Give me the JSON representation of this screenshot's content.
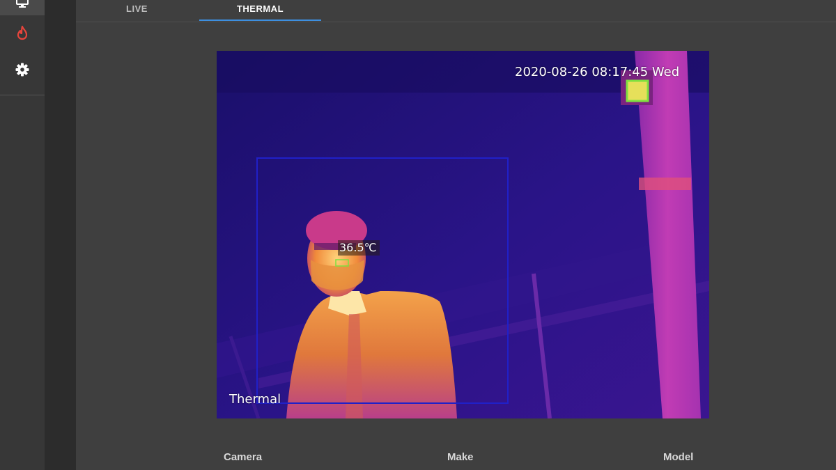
{
  "sidebar": {
    "items": [
      {
        "name": "monitor",
        "icon": "monitor-icon",
        "active": true
      },
      {
        "name": "thermal",
        "icon": "flame-icon",
        "color": "#e8453c"
      },
      {
        "name": "settings",
        "icon": "gear-icon"
      }
    ]
  },
  "tabs": [
    {
      "label": "LIVE",
      "active": false
    },
    {
      "label": "THERMAL",
      "active": true
    }
  ],
  "feed": {
    "timestamp": "2020-08-26 08:17:45 Wed",
    "temperature": "36.5℃",
    "label": "Thermal"
  },
  "info": {
    "camera_label": "Camera",
    "make_label": "Make",
    "model_label": "Model"
  },
  "colors": {
    "accent": "#3d8fe0",
    "detection_box": "#2020c8",
    "reference_box": "#7fe040"
  }
}
